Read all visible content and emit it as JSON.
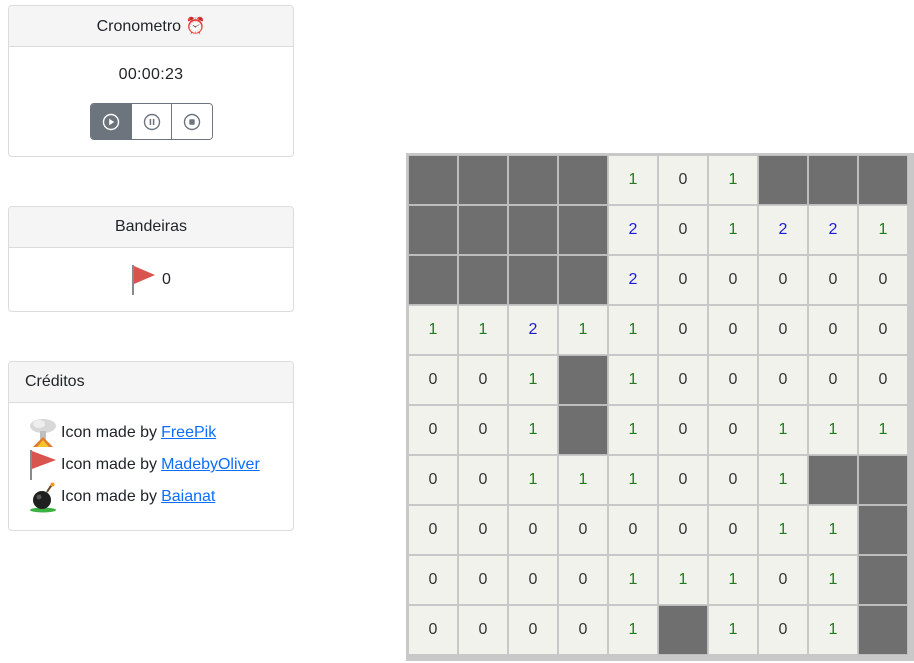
{
  "timer": {
    "title": "Cronometro ⏰",
    "value": "00:00:23",
    "buttons": [
      {
        "name": "play",
        "active": true
      },
      {
        "name": "pause",
        "active": false
      },
      {
        "name": "stop",
        "active": false
      }
    ]
  },
  "flags": {
    "title": "Bandeiras",
    "count": "0"
  },
  "credits": {
    "title": "Créditos",
    "items": [
      {
        "icon": "explosion-icon",
        "text": "Icon made by",
        "link": "FreePik"
      },
      {
        "icon": "flag-icon",
        "text": "Icon made by",
        "link": "MadebyOliver"
      },
      {
        "icon": "bomb-icon",
        "text": "Icon made by",
        "link": "Baianat"
      }
    ]
  },
  "colors": {
    "hidden_cell": "#6f6f6f",
    "open_cell": "#f2f2ed",
    "number_1": "#1a7f1a",
    "number_2": "#1a1ad8",
    "flag_red": "#d9534f",
    "active_button": "#6c757d"
  },
  "board": {
    "rows": 10,
    "cols": 10,
    "cells": [
      [
        "#",
        "#",
        "#",
        "#",
        "1",
        "0",
        "1",
        "#",
        "#",
        "#"
      ],
      [
        "#",
        "#",
        "#",
        "#",
        "2",
        "0",
        "1",
        "2",
        "2",
        "1"
      ],
      [
        "#",
        "#",
        "#",
        "#",
        "2",
        "0",
        "0",
        "0",
        "0",
        "0"
      ],
      [
        "1",
        "1",
        "2",
        "1",
        "1",
        "0",
        "0",
        "0",
        "0",
        "0"
      ],
      [
        "0",
        "0",
        "1",
        "#",
        "1",
        "0",
        "0",
        "0",
        "0",
        "0"
      ],
      [
        "0",
        "0",
        "1",
        "#",
        "1",
        "0",
        "0",
        "1",
        "1",
        "1"
      ],
      [
        "0",
        "0",
        "1",
        "1",
        "1",
        "0",
        "0",
        "1",
        "#",
        "#"
      ],
      [
        "0",
        "0",
        "0",
        "0",
        "0",
        "0",
        "0",
        "1",
        "1",
        "#"
      ],
      [
        "0",
        "0",
        "0",
        "0",
        "1",
        "1",
        "1",
        "0",
        "1",
        "#"
      ],
      [
        "0",
        "0",
        "0",
        "0",
        "1",
        "#",
        "1",
        "0",
        "1",
        "#"
      ]
    ]
  }
}
